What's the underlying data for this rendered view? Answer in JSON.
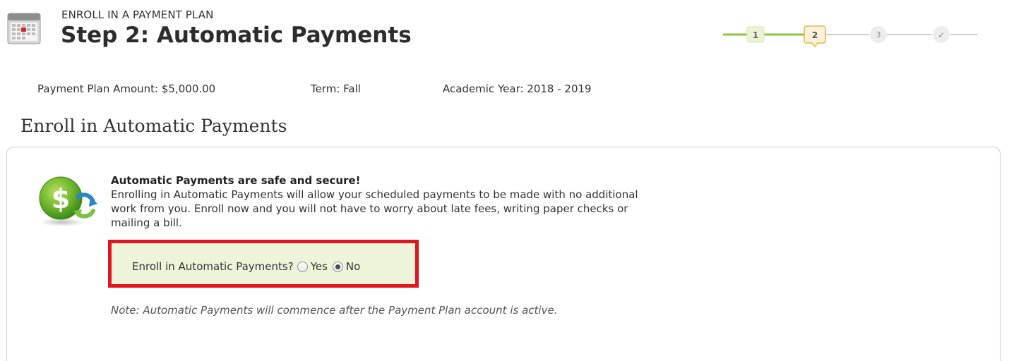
{
  "header": {
    "eyebrow": "ENROLL IN A PAYMENT PLAN",
    "title": "Step 2: Automatic Payments",
    "icon": "calendar-icon"
  },
  "stepper": {
    "steps": [
      {
        "label": "1",
        "state": "complete"
      },
      {
        "label": "2",
        "state": "current"
      },
      {
        "label": "3",
        "state": "upcoming"
      },
      {
        "label": "✓",
        "state": "upcoming"
      }
    ],
    "colors": {
      "complete": "#8cc63f",
      "current": "#f0b24a",
      "upcoming": "#cccccc"
    }
  },
  "info": {
    "amount": "Payment Plan Amount: $5,000.00",
    "term": "Term: Fall",
    "year": "Academic Year: 2018 - 2019"
  },
  "section": {
    "title": "Enroll in Automatic Payments"
  },
  "panel": {
    "icon": "dollar-refresh-icon",
    "headline": "Automatic Payments are safe and secure!",
    "body": "Enrolling in Automatic Payments will allow your scheduled payments to be made with no additional work from you. Enroll now and you will not have to worry about late fees, writing paper checks or mailing a bill.",
    "question": "Enroll in Automatic Payments?",
    "options": [
      {
        "label": "Yes",
        "selected": false
      },
      {
        "label": "No",
        "selected": true
      }
    ],
    "note": "Note: Automatic Payments will commence after the Payment Plan account is active.",
    "highlight_color": "#e3151f",
    "box_color": "#eef4d9"
  }
}
